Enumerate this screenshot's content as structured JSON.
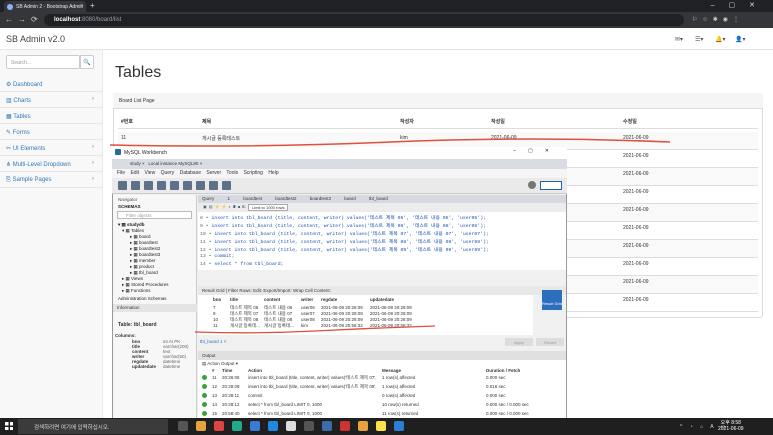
{
  "browser": {
    "tab_title": "SB Admin 2 - Bootstrap Admin",
    "url_host": "localhost",
    "url_rest": ":8080/board/list"
  },
  "admin": {
    "brand": "SB Admin v2.0",
    "search_placeholder": "Search...",
    "sidebar": [
      "Dashboard",
      "Charts",
      "Tables",
      "Forms",
      "UI Elements",
      "Multi-Level Dropdown",
      "Sample Pages"
    ],
    "page_title": "Tables",
    "panel_heading": "Board List Page",
    "columns": [
      "#번호",
      "제목",
      "작성자",
      "작성일",
      "수정일"
    ],
    "rows": [
      {
        "no": "11",
        "title": "게시글 등록테스트",
        "writer": "kim",
        "reg": "2021-06-09",
        "upd": "2021-06-09"
      },
      {
        "no": "",
        "title": "",
        "writer": "",
        "reg": "",
        "upd": "2021-06-09"
      },
      {
        "no": "",
        "title": "",
        "writer": "",
        "reg": "",
        "upd": "2021-06-09"
      },
      {
        "no": "",
        "title": "",
        "writer": "",
        "reg": "",
        "upd": "2021-06-09"
      },
      {
        "no": "",
        "title": "",
        "writer": "",
        "reg": "",
        "upd": "2021-06-09"
      },
      {
        "no": "",
        "title": "",
        "writer": "",
        "reg": "",
        "upd": "2021-06-09"
      },
      {
        "no": "",
        "title": "",
        "writer": "",
        "reg": "",
        "upd": "2021-06-09"
      },
      {
        "no": "",
        "title": "",
        "writer": "",
        "reg": "",
        "upd": "2021-06-09"
      },
      {
        "no": "",
        "title": "",
        "writer": "",
        "reg": "",
        "upd": "2021-06-09"
      },
      {
        "no": "",
        "title": "",
        "writer": "",
        "reg": "",
        "upd": "2021-06-09"
      }
    ]
  },
  "workbench": {
    "title": "MySQL Workbench",
    "tabs": [
      "study",
      "Local instance MySQL80"
    ],
    "menu": "File  Edit  View  Query  Database  Server  Tools  Scripting  Help",
    "query_tabs": "Query 1  boardtest  boardtest2  boardtest3  board  tbl_board",
    "limit": "Limit to 1000 rows",
    "navigator": "Navigator",
    "schemas": "SCHEMAS",
    "filter": "Filter objects",
    "tree": [
      "studydb",
      "Tables",
      "board",
      "boardtest",
      "boardtest2",
      "boardtest3",
      "member",
      "product",
      "tbl_board",
      "Views",
      "Stored Procedures",
      "Functions"
    ],
    "nav_tabs": "Administration  Schemas",
    "info": "Information",
    "table_label": "Table: tbl_board",
    "columns_label": "Columns:",
    "col_defs": [
      [
        "bno",
        "int AI PK"
      ],
      [
        "title",
        "varchar(200)"
      ],
      [
        "content",
        "text"
      ],
      [
        "writer",
        "varchar(50)"
      ],
      [
        "regdate",
        "datetime"
      ],
      [
        "updatedate",
        "datetime"
      ]
    ],
    "code": [
      {
        "ln": "8",
        "body": "insert into tbl_board (title, content, writer) values('테스트 제목 05', '테스트 내용 05', 'user05');"
      },
      {
        "ln": "9",
        "body": "insert into tbl_board (title, content, writer) values('테스트 제목 06', '테스트 내용 06', 'user06');"
      },
      {
        "ln": "10",
        "body": "insert into tbl_board (title, content, writer) values('테스트 제목 07', '테스트 내용 07', 'user07');"
      },
      {
        "ln": "11",
        "body": "insert into tbl_board (title, content, writer) values('테스트 제목 08', '테스트 내용 08', 'user08');"
      },
      {
        "ln": "12",
        "body": "insert into tbl_board (title, content, writer) values('테스트 제목 09', '테스트 내용 09', 'user09');"
      },
      {
        "ln": "13",
        "body": "commit;"
      },
      {
        "ln": "14",
        "body": "select * from tbl_board;"
      }
    ],
    "result_bar": "Result Grid  |  Filter Rows:        Edit:      Export/Import:     Wrap Cell Content:",
    "grid_head": [
      "bno",
      "title",
      "content",
      "writer",
      "regdate",
      "updatedate"
    ],
    "grid_rows": [
      [
        "7",
        "테스트 제목 06",
        "테스트 내용 06",
        "user06",
        "2021-06-09 20:28:09",
        "2021-06-09 20:28:09"
      ],
      [
        "9",
        "테스트 제목 07",
        "테스트 내용 07",
        "user07",
        "2021-06-09 20:28:09",
        "2021-06-09 20:28:09"
      ],
      [
        "10",
        "테스트 제목 08",
        "테스트 내용 08",
        "user08",
        "2021-06-09 20:28:09",
        "2021-06-09 20:28:09"
      ],
      [
        "11",
        "게시글 등록테...",
        "게시글 등록테...",
        "kim",
        "2021-06-09 20:58:32",
        "2021-06-09 20:58:32"
      ]
    ],
    "result_tab": "tbl_board 1 ×",
    "output": "Output",
    "action_output": "Action Output",
    "out_head": [
      "#",
      "Time",
      "Action",
      "Message",
      "Duration / Fetch"
    ],
    "out_rows": [
      [
        "11",
        "20:26:06",
        "insert into tbl_board (title, content, writer) values('테스트 제목 07', '...",
        "1 row(s) affected",
        "0.000 sec"
      ],
      [
        "12",
        "20:28:09",
        "insert into tbl_board (title, content, writer) values('테스트 제목 08', '...",
        "1 row(s) affected",
        "0.016 sec"
      ],
      [
        "13",
        "20:28:11",
        "commit",
        "0 row(s) affected",
        "0.000 sec"
      ],
      [
        "14",
        "20:28:12",
        "select * from tbl_board LIMIT 0, 1000",
        "10 row(s) returned",
        "0.000 sec / 0.000 sec"
      ],
      [
        "15",
        "20:58:40",
        "select * from tbl_board LIMIT 0, 1000",
        "11 row(s) returned",
        "0.000 sec / 0.000 sec"
      ]
    ],
    "apply": "Apply",
    "revert": "Revert",
    "result_side": "Result Grid"
  },
  "taskbar": {
    "search": "검색하려면 여기에 입력하십시오.",
    "time": "오후 8:58",
    "date": "2021-06-09"
  },
  "colors": {
    "link": "#337ab7",
    "red_underline": "#e0503c"
  }
}
